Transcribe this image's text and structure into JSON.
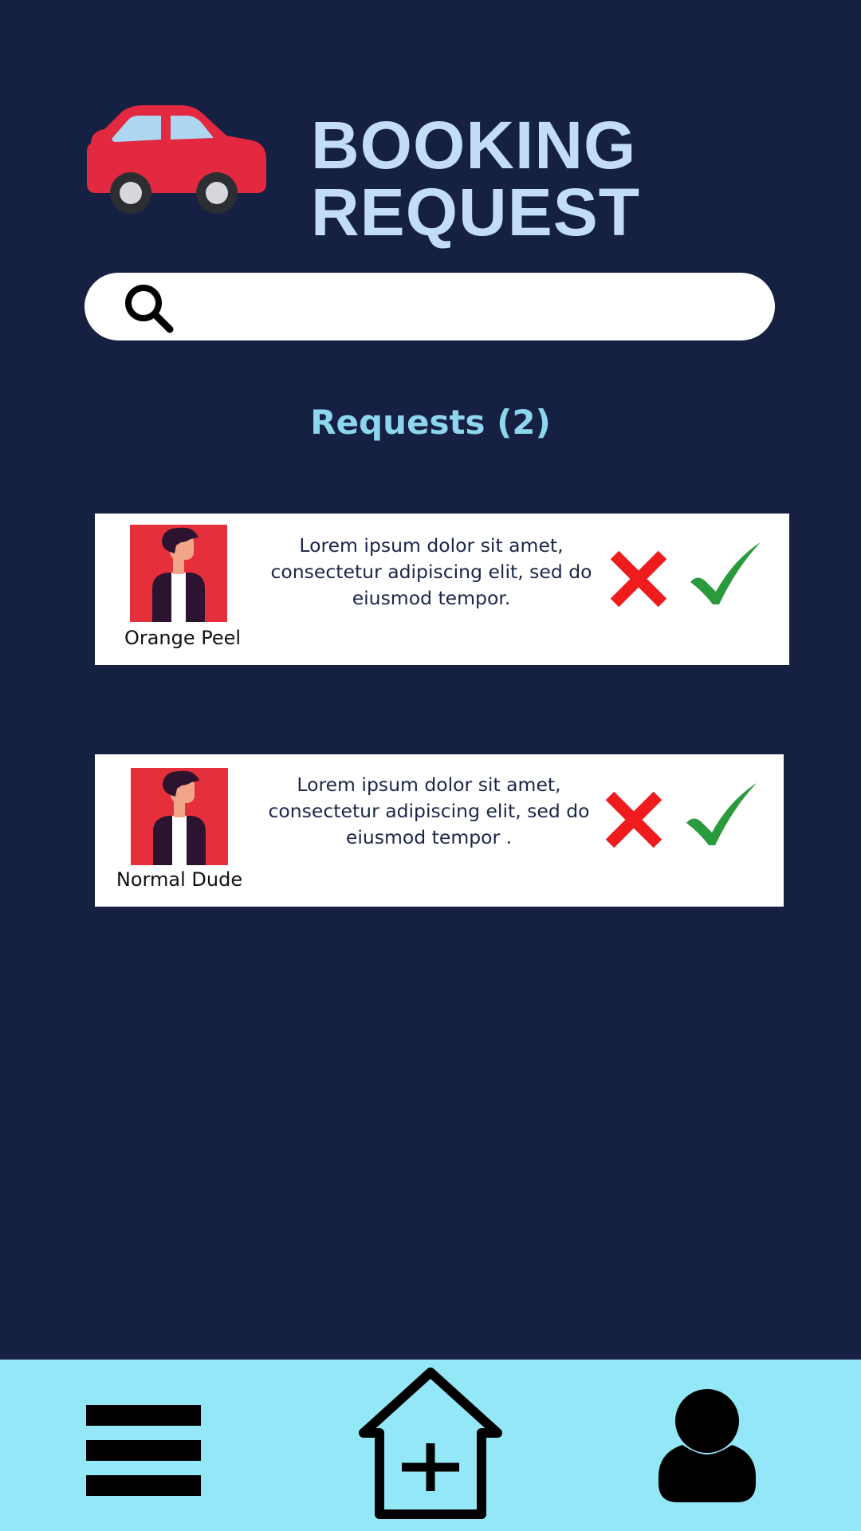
{
  "header": {
    "logo_icon": "car-icon",
    "title_line1": "BOOKING",
    "title_line2": "REQUEST"
  },
  "search": {
    "icon": "search-icon",
    "value": "",
    "placeholder": ""
  },
  "requests": {
    "heading": "Requests (2)",
    "items": [
      {
        "name": "Orange Peel",
        "message": "Lorem ipsum dolor sit amet, consectetur adipiscing elit, sed do eiusmod tempor.",
        "decline_icon": "x-icon",
        "accept_icon": "checkmark-icon"
      },
      {
        "name": "Normal Dude",
        "message": "Lorem ipsum dolor sit amet, consectetur adipiscing elit, sed do eiusmod tempor .",
        "decline_icon": "x-icon",
        "accept_icon": "checkmark-icon"
      }
    ]
  },
  "bottom_nav": {
    "items": [
      {
        "icon": "menu-icon"
      },
      {
        "icon": "home-add-icon"
      },
      {
        "icon": "user-icon"
      }
    ]
  },
  "colors": {
    "background": "#152042",
    "title": "#c2ddf5",
    "heading": "#8ed6ee",
    "nav_background": "#93e7f6",
    "decline": "#ee1c1c",
    "accept": "#2a9a3c",
    "avatar_background": "#e5303b",
    "car_body": "#e2293f"
  }
}
